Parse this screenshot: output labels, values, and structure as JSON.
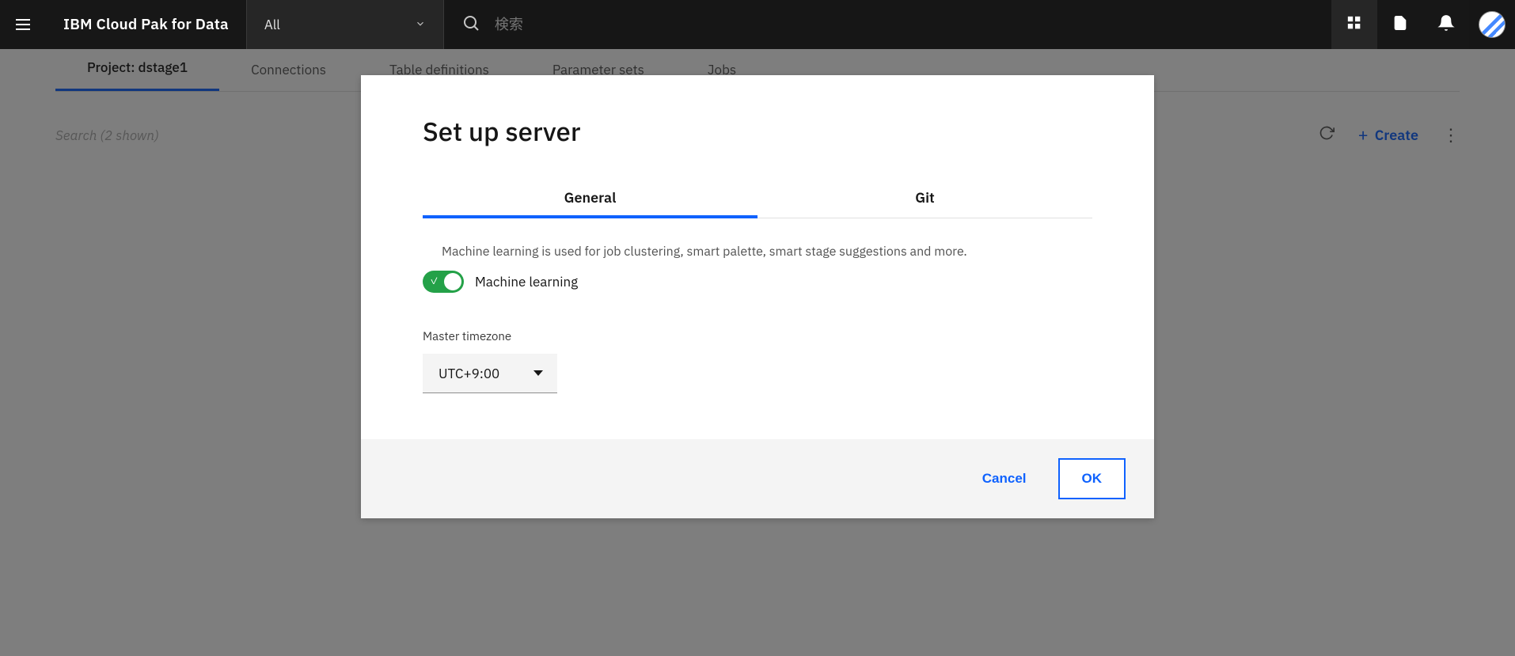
{
  "header": {
    "brand": "IBM Cloud Pak for Data",
    "selector_value": "All",
    "search_placeholder": "検索"
  },
  "background": {
    "tabs": [
      "Project: dstage1",
      "Connections",
      "Table definitions",
      "Parameter sets",
      "Jobs"
    ],
    "active_tab_index": 0,
    "search_hint": "Search (2 shown)",
    "create_label": "Create"
  },
  "modal": {
    "title": "Set up server",
    "tabs": [
      "General",
      "Git"
    ],
    "active_tab_index": 0,
    "ml_description": "Machine learning is used for job clustering, smart palette, smart stage suggestions and more.",
    "ml_toggle_label": "Machine learning",
    "ml_toggle_on": true,
    "timezone_label": "Master timezone",
    "timezone_value": "UTC+9:00",
    "cancel": "Cancel",
    "ok": "OK"
  },
  "colors": {
    "primary": "#0f62fe",
    "success": "#24a148",
    "header_bg": "#171717"
  }
}
